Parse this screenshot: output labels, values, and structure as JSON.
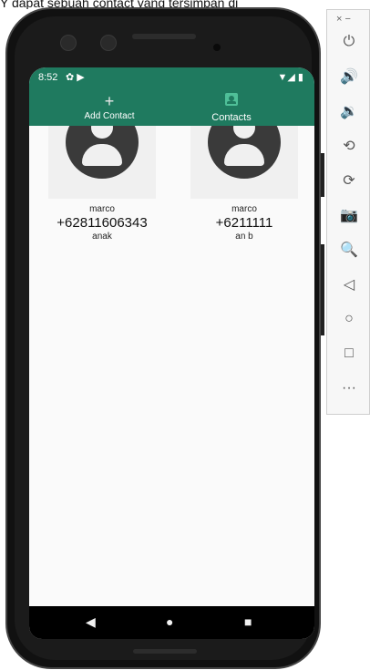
{
  "top_partial_text": "Y dapat sebuah contact yang tersimpan di",
  "status": {
    "time": "8:52",
    "left_icons": "✿ ▶",
    "right_icons": "▼◢ ▮"
  },
  "tabs": [
    {
      "label": "Add Contact",
      "icon": "+"
    },
    {
      "label": "Contacts",
      "icon": "contacts-icon"
    }
  ],
  "contacts": [
    {
      "name": "marco",
      "phone": "+62811606343",
      "relation": "anak"
    },
    {
      "name": "marco",
      "phone": "+6211111",
      "relation": "an b"
    }
  ],
  "nav": {
    "back": "◀",
    "home": "●",
    "recent": "■"
  },
  "toolbar": {
    "top": "×  −",
    "buttons": [
      "power-icon",
      "volume-up-icon",
      "volume-down-icon",
      "rotate-left-icon",
      "rotate-right-icon",
      "camera-icon",
      "zoom-icon",
      "back-icon",
      "home-icon",
      "overview-icon",
      "more-icon"
    ],
    "glyphs": [
      "⏻",
      "🔊",
      "🔉",
      "⟲",
      "⟳",
      "📷",
      "🔍",
      "◁",
      "○",
      "□",
      "···"
    ]
  },
  "colors": {
    "appbar": "#1f7a5f",
    "screen_bg": "#fafafa",
    "frame": "#111111"
  }
}
